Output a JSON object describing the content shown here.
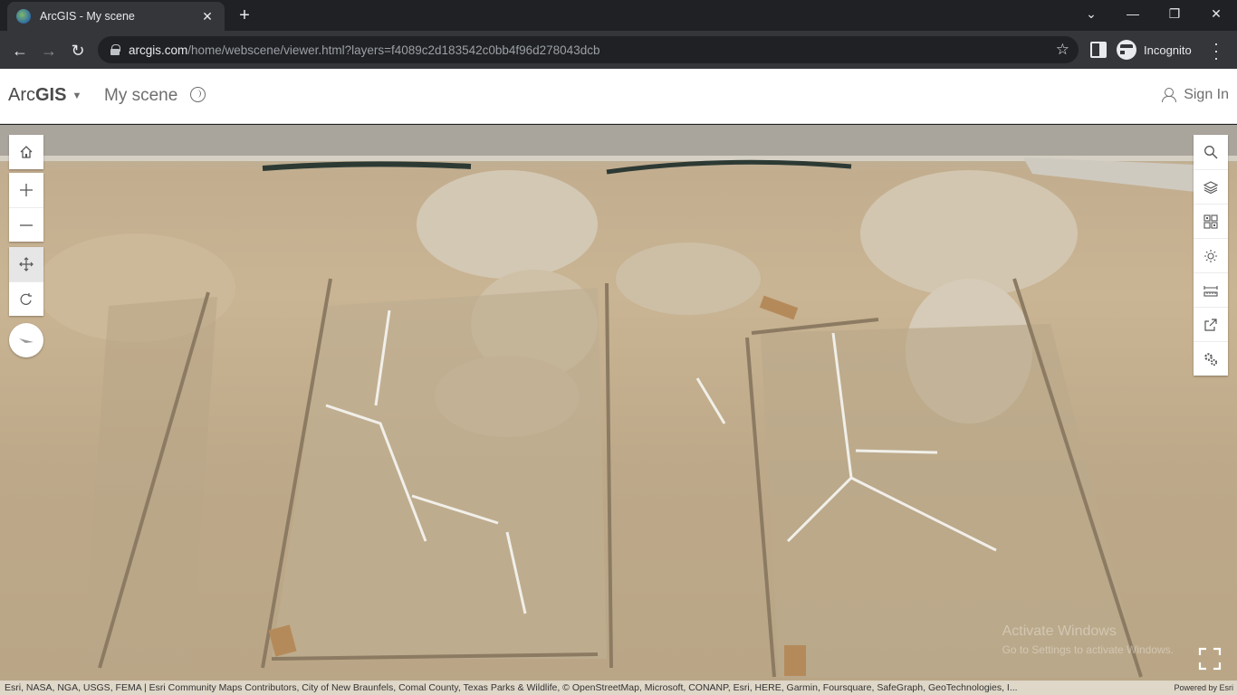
{
  "browser": {
    "tab_title": "ArcGIS - My scene",
    "url_host": "arcgis.com",
    "url_path": "/home/webscene/viewer.html?layers=f4089c2d183542c0bb4f96d278043dcb",
    "incognito_label": "Incognito"
  },
  "header": {
    "brand_regular": "Arc",
    "brand_bold": "GIS",
    "scene_title": "My scene",
    "sign_in": "Sign In"
  },
  "map": {
    "left_tools": [
      "home-icon",
      "zoom-in-icon",
      "zoom-out-icon",
      "pan-icon",
      "rotate-icon",
      "compass-icon"
    ],
    "right_tools": [
      "search-icon",
      "layers-icon",
      "basemap-gallery-icon",
      "daylight-icon",
      "measure-icon",
      "share-icon",
      "settings-icon"
    ],
    "attribution": "Esri, NASA, NGA, USGS, FEMA | Esri Community Maps Contributors, City of New Braunfels, Comal County, Texas Parks & Wildlife, © OpenStreetMap, Microsoft, CONANP, Esri, HERE, Garmin, Foursquare, SafeGraph, GeoTechnologies, I...",
    "powered_by": "Powered by Esri",
    "watermark_title": "Activate Windows",
    "watermark_sub": "Go to Settings to activate Windows."
  }
}
